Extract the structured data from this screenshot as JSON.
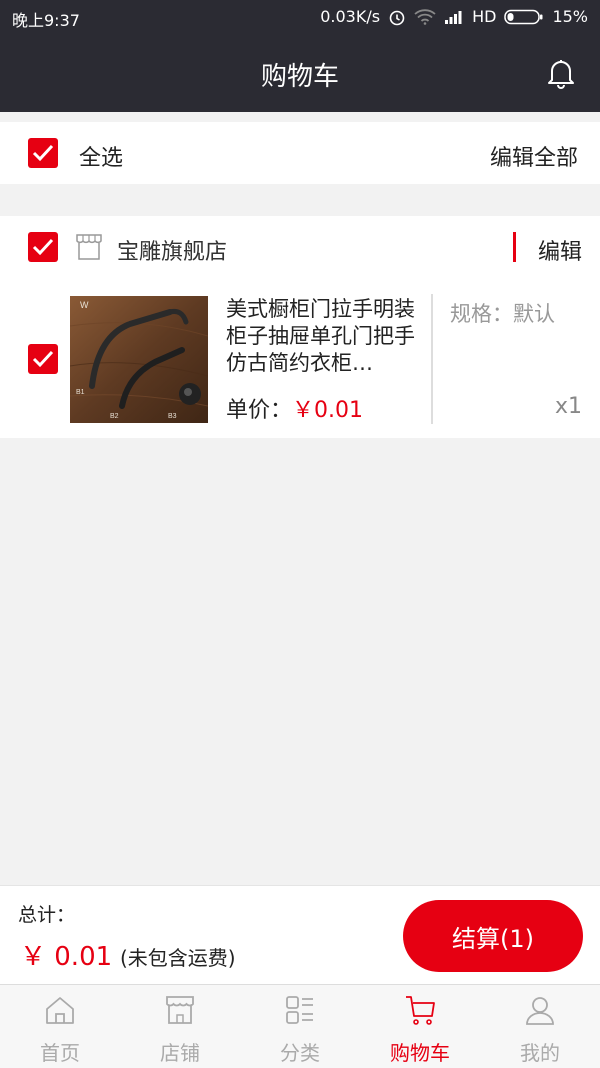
{
  "status_bar": {
    "time": "晚上9:37",
    "network_speed": "0.03K/s",
    "network_type": "HD",
    "battery": "15%"
  },
  "header": {
    "title": "购物车"
  },
  "select_all": {
    "label": "全选",
    "edit_all": "编辑全部",
    "checked": true
  },
  "shop": {
    "name": "宝雕旗舰店",
    "edit_label": "编辑",
    "checked": true,
    "items": [
      {
        "title": "美式橱柜门拉手明装柜子抽屉单孔门把手仿古简约衣柜…",
        "price_label": "单价：",
        "price": "￥0.01",
        "spec": "规格：默认",
        "qty": "x1",
        "checked": true,
        "image_labels": [
          "B1",
          "B2",
          "B3"
        ]
      }
    ]
  },
  "summary": {
    "total_label": "总计：",
    "total_value": "￥ 0.01",
    "note": "(未包含运费)",
    "checkout_label": "结算(1)"
  },
  "tabs": [
    {
      "label": "首页",
      "icon": "home-icon",
      "active": false
    },
    {
      "label": "店铺",
      "icon": "store-icon",
      "active": false
    },
    {
      "label": "分类",
      "icon": "category-icon",
      "active": false
    },
    {
      "label": "购物车",
      "icon": "cart-icon",
      "active": true
    },
    {
      "label": "我的",
      "icon": "user-icon",
      "active": false
    }
  ],
  "colors": {
    "accent": "#e60012",
    "header_bg": "#2b2b33",
    "background": "#f2f2f2"
  }
}
